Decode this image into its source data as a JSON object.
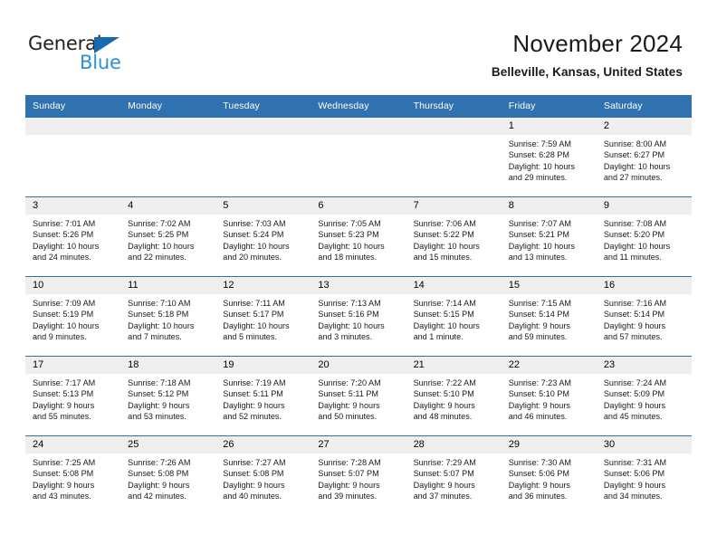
{
  "brand": {
    "name_part1": "General",
    "name_part2": "Blue",
    "logo_icon": "blue-triangle-logo"
  },
  "header": {
    "title": "November 2024",
    "location": "Belleville, Kansas, United States"
  },
  "calendar": {
    "weekday_headers": [
      "Sunday",
      "Monday",
      "Tuesday",
      "Wednesday",
      "Thursday",
      "Friday",
      "Saturday"
    ],
    "colors": {
      "header_blue": "#3071b0",
      "daynum_gray": "#efefef",
      "brand_blue": "#2f8fd4",
      "brand_dark": "#231f20"
    },
    "weeks": [
      [
        {
          "day": "",
          "empty": true
        },
        {
          "day": "",
          "empty": true
        },
        {
          "day": "",
          "empty": true
        },
        {
          "day": "",
          "empty": true
        },
        {
          "day": "",
          "empty": true
        },
        {
          "day": "1",
          "sunrise": "Sunrise: 7:59 AM",
          "sunset": "Sunset: 6:28 PM",
          "daylight1": "Daylight: 10 hours",
          "daylight2": "and 29 minutes."
        },
        {
          "day": "2",
          "sunrise": "Sunrise: 8:00 AM",
          "sunset": "Sunset: 6:27 PM",
          "daylight1": "Daylight: 10 hours",
          "daylight2": "and 27 minutes."
        }
      ],
      [
        {
          "day": "3",
          "sunrise": "Sunrise: 7:01 AM",
          "sunset": "Sunset: 5:26 PM",
          "daylight1": "Daylight: 10 hours",
          "daylight2": "and 24 minutes."
        },
        {
          "day": "4",
          "sunrise": "Sunrise: 7:02 AM",
          "sunset": "Sunset: 5:25 PM",
          "daylight1": "Daylight: 10 hours",
          "daylight2": "and 22 minutes."
        },
        {
          "day": "5",
          "sunrise": "Sunrise: 7:03 AM",
          "sunset": "Sunset: 5:24 PM",
          "daylight1": "Daylight: 10 hours",
          "daylight2": "and 20 minutes."
        },
        {
          "day": "6",
          "sunrise": "Sunrise: 7:05 AM",
          "sunset": "Sunset: 5:23 PM",
          "daylight1": "Daylight: 10 hours",
          "daylight2": "and 18 minutes."
        },
        {
          "day": "7",
          "sunrise": "Sunrise: 7:06 AM",
          "sunset": "Sunset: 5:22 PM",
          "daylight1": "Daylight: 10 hours",
          "daylight2": "and 15 minutes."
        },
        {
          "day": "8",
          "sunrise": "Sunrise: 7:07 AM",
          "sunset": "Sunset: 5:21 PM",
          "daylight1": "Daylight: 10 hours",
          "daylight2": "and 13 minutes."
        },
        {
          "day": "9",
          "sunrise": "Sunrise: 7:08 AM",
          "sunset": "Sunset: 5:20 PM",
          "daylight1": "Daylight: 10 hours",
          "daylight2": "and 11 minutes."
        }
      ],
      [
        {
          "day": "10",
          "sunrise": "Sunrise: 7:09 AM",
          "sunset": "Sunset: 5:19 PM",
          "daylight1": "Daylight: 10 hours",
          "daylight2": "and 9 minutes."
        },
        {
          "day": "11",
          "sunrise": "Sunrise: 7:10 AM",
          "sunset": "Sunset: 5:18 PM",
          "daylight1": "Daylight: 10 hours",
          "daylight2": "and 7 minutes."
        },
        {
          "day": "12",
          "sunrise": "Sunrise: 7:11 AM",
          "sunset": "Sunset: 5:17 PM",
          "daylight1": "Daylight: 10 hours",
          "daylight2": "and 5 minutes."
        },
        {
          "day": "13",
          "sunrise": "Sunrise: 7:13 AM",
          "sunset": "Sunset: 5:16 PM",
          "daylight1": "Daylight: 10 hours",
          "daylight2": "and 3 minutes."
        },
        {
          "day": "14",
          "sunrise": "Sunrise: 7:14 AM",
          "sunset": "Sunset: 5:15 PM",
          "daylight1": "Daylight: 10 hours",
          "daylight2": "and 1 minute."
        },
        {
          "day": "15",
          "sunrise": "Sunrise: 7:15 AM",
          "sunset": "Sunset: 5:14 PM",
          "daylight1": "Daylight: 9 hours",
          "daylight2": "and 59 minutes."
        },
        {
          "day": "16",
          "sunrise": "Sunrise: 7:16 AM",
          "sunset": "Sunset: 5:14 PM",
          "daylight1": "Daylight: 9 hours",
          "daylight2": "and 57 minutes."
        }
      ],
      [
        {
          "day": "17",
          "sunrise": "Sunrise: 7:17 AM",
          "sunset": "Sunset: 5:13 PM",
          "daylight1": "Daylight: 9 hours",
          "daylight2": "and 55 minutes."
        },
        {
          "day": "18",
          "sunrise": "Sunrise: 7:18 AM",
          "sunset": "Sunset: 5:12 PM",
          "daylight1": "Daylight: 9 hours",
          "daylight2": "and 53 minutes."
        },
        {
          "day": "19",
          "sunrise": "Sunrise: 7:19 AM",
          "sunset": "Sunset: 5:11 PM",
          "daylight1": "Daylight: 9 hours",
          "daylight2": "and 52 minutes."
        },
        {
          "day": "20",
          "sunrise": "Sunrise: 7:20 AM",
          "sunset": "Sunset: 5:11 PM",
          "daylight1": "Daylight: 9 hours",
          "daylight2": "and 50 minutes."
        },
        {
          "day": "21",
          "sunrise": "Sunrise: 7:22 AM",
          "sunset": "Sunset: 5:10 PM",
          "daylight1": "Daylight: 9 hours",
          "daylight2": "and 48 minutes."
        },
        {
          "day": "22",
          "sunrise": "Sunrise: 7:23 AM",
          "sunset": "Sunset: 5:10 PM",
          "daylight1": "Daylight: 9 hours",
          "daylight2": "and 46 minutes."
        },
        {
          "day": "23",
          "sunrise": "Sunrise: 7:24 AM",
          "sunset": "Sunset: 5:09 PM",
          "daylight1": "Daylight: 9 hours",
          "daylight2": "and 45 minutes."
        }
      ],
      [
        {
          "day": "24",
          "sunrise": "Sunrise: 7:25 AM",
          "sunset": "Sunset: 5:08 PM",
          "daylight1": "Daylight: 9 hours",
          "daylight2": "and 43 minutes."
        },
        {
          "day": "25",
          "sunrise": "Sunrise: 7:26 AM",
          "sunset": "Sunset: 5:08 PM",
          "daylight1": "Daylight: 9 hours",
          "daylight2": "and 42 minutes."
        },
        {
          "day": "26",
          "sunrise": "Sunrise: 7:27 AM",
          "sunset": "Sunset: 5:08 PM",
          "daylight1": "Daylight: 9 hours",
          "daylight2": "and 40 minutes."
        },
        {
          "day": "27",
          "sunrise": "Sunrise: 7:28 AM",
          "sunset": "Sunset: 5:07 PM",
          "daylight1": "Daylight: 9 hours",
          "daylight2": "and 39 minutes."
        },
        {
          "day": "28",
          "sunrise": "Sunrise: 7:29 AM",
          "sunset": "Sunset: 5:07 PM",
          "daylight1": "Daylight: 9 hours",
          "daylight2": "and 37 minutes."
        },
        {
          "day": "29",
          "sunrise": "Sunrise: 7:30 AM",
          "sunset": "Sunset: 5:06 PM",
          "daylight1": "Daylight: 9 hours",
          "daylight2": "and 36 minutes."
        },
        {
          "day": "30",
          "sunrise": "Sunrise: 7:31 AM",
          "sunset": "Sunset: 5:06 PM",
          "daylight1": "Daylight: 9 hours",
          "daylight2": "and 34 minutes."
        }
      ]
    ]
  }
}
